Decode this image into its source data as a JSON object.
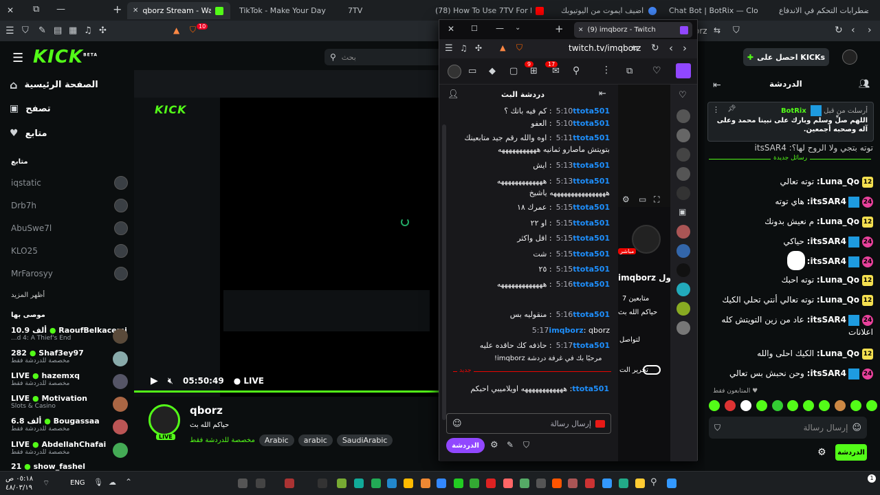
{
  "tabs": [
    {
      "label": "qborz Stream - Watch Live",
      "color": "#53fc18",
      "active": true
    },
    {
      "label": "TikTok - Make Your Day",
      "color": "#111111"
    },
    {
      "label": "7TV",
      "color": "#6f6f6f"
    },
    {
      "label": "(78) How To Use 7TV For Extra",
      "color": "#ff0000"
    },
    {
      "label": "كيف اضيف ايموت من اليوتيوبك",
      "color": "#4285f4"
    },
    {
      "label": "Chat Bot | BotRix — Cloud Stre",
      "color": "#5b8dee"
    },
    {
      "label": "اضطرابات التحكم في الاندفاع",
      "color": "#888888"
    }
  ],
  "toolbar": {
    "shield_count": "10",
    "url_partial": "orz"
  },
  "kick": {
    "logo": "KICK",
    "logo_beta": "BETA",
    "search_placeholder": "بحث",
    "nav": [
      {
        "label": "الصفحة الرئيسية",
        "icon": "home-icon"
      },
      {
        "label": "تصفح",
        "icon": "browse-icon"
      },
      {
        "label": "متابع",
        "icon": "heart-icon"
      }
    ],
    "following_title": "متابع",
    "following": [
      "iqstatic",
      "Drb7h",
      "AbuSwe7l",
      "KLO25",
      "MrFarosyy"
    ],
    "show_more": "أظهر المزيد",
    "recommended_title": "موصى بها",
    "recommended": [
      {
        "count": "10.9 ألف",
        "name": "RaoufBelkacemi",
        "sub": "...d 4: A Thief's End"
      },
      {
        "count": "282",
        "name": "Shaf3ey97",
        "sub": "مخصصة للدردشة فقط"
      },
      {
        "count": "LIVE",
        "name": "hazemxq",
        "sub": "مخصصة للدردشة فقط"
      },
      {
        "count": "LIVE",
        "name": "Motivation",
        "sub": "Slots & Casino"
      },
      {
        "count": "6.8 ألف",
        "name": "Bougassaa",
        "sub": "مخصصة للدردشة فقط"
      },
      {
        "count": "LIVE",
        "name": "AbdellahChafai",
        "sub": "مخصصة للدردشة فقط"
      },
      {
        "count": "21",
        "name": "show_fashel",
        "sub": ""
      }
    ],
    "player": {
      "time": "05:50:49",
      "live": "LIVE"
    },
    "streamer": {
      "name": "qborz",
      "title": "حياكم الله بث",
      "category": "مخصصة للدردشة فقط",
      "live_badge": "LIVE",
      "tags": [
        "Arabic",
        "arabic",
        "SaudiArabic"
      ]
    }
  },
  "twitch": {
    "tab_title": "(9) imqborz - Twitch",
    "url": "twitch.tv/imqborz",
    "badge_count": "9",
    "notif_count": "17",
    "chat_header": "دردشة البث",
    "messages": [
      {
        "time": "5:10",
        "user": "ttota501",
        "text": "كم فيه باتك ؟"
      },
      {
        "time": "5:10",
        "user": "ttota501",
        "text": "العفو"
      },
      {
        "time": "5:11",
        "user": "ttota501",
        "text": "اوه والله رقم جيد متابعينك بتويتش ماصارو ثمانيه هههههههههههه"
      },
      {
        "time": "5:13",
        "user": "ttota501",
        "text": "ايش"
      },
      {
        "time": "5:13",
        "user": "ttota501",
        "text": "هههههههههههههه ههههههههههههههههه ياشيخ"
      },
      {
        "time": "5:15",
        "user": "ttota501",
        "text": "عمرك ١٨"
      },
      {
        "time": "5:15",
        "user": "ttota501",
        "text": "او ٢٢"
      },
      {
        "time": "5:15",
        "user": "ttota501",
        "text": "اقل واكثر"
      },
      {
        "time": "5:15",
        "user": "ttota501",
        "text": "شت"
      },
      {
        "time": "5:15",
        "user": "ttota501",
        "text": "٢٥"
      },
      {
        "time": "5:16",
        "user": "ttota501",
        "text": "هههههههههههههه"
      },
      {
        "time": "5:16",
        "user": "ttota501",
        "text": "منقوليه بس"
      },
      {
        "time": "5:17",
        "user": "imqborz",
        "text": "qborz"
      },
      {
        "time": "5:17",
        "user": "ttota501",
        "text": "حاذفه كك حاقده عليه"
      }
    ],
    "welcome": "مرحبًا بك في غرفة دردشة imqborz!",
    "new_label": "جديد",
    "new_msg": {
      "user": "ttota501",
      "text": "ههههههههههههه اويلاميبي احبكم"
    },
    "input_placeholder": "إرسال رسالة",
    "chat_button": "الدردشة",
    "about_title": "حول imqborz",
    "followers": "7 متابعين",
    "bio": "حياكم الله بث",
    "social": "لتواصل",
    "edit_label": "تحرير الت",
    "live_label": "مباشر"
  },
  "kchat": {
    "get_kicks": "احصل على KICKs",
    "title": "الدردشة",
    "pinned_user": "BotRix",
    "pinned_by": "أرسلت من قبل",
    "pinned_text": "اللهم صلِّ وسلم وبارك على نبينا محمد وعلى آله وصحبه أجمعين.",
    "partial_msg": "توته بتجي ولا الروح لها؟: itsSAR4",
    "new_messages": "رسائل جديدة",
    "messages": [
      {
        "badge": "12",
        "user": "Luna_Qo",
        "text": "توته تعالي"
      },
      {
        "badge": "24",
        "user": "itsSAR4",
        "text": "هاي توته"
      },
      {
        "badge": "12",
        "user": "Luna_Qo",
        "text": "م نعيش بدونك"
      },
      {
        "badge": "24",
        "user": "itsSAR4",
        "text": "حياكي"
      },
      {
        "badge": "24",
        "user": "itsSAR4",
        "text": ""
      },
      {
        "badge": "12",
        "user": "Luna_Qo",
        "text": "توته احبك"
      },
      {
        "badge": "12",
        "user": "Luna_Qo",
        "text": "توته تعالي أنتي تحلي الكيك"
      },
      {
        "badge": "24",
        "user": "itsSAR4",
        "text": "عاد من زين التويتش كله اعلانات"
      },
      {
        "badge": "12",
        "user": "Luna_Qo",
        "text": "الكيك احلى والله"
      },
      {
        "badge": "24",
        "user": "itsSAR4",
        "text": "وحن نحبش بس تعالي"
      }
    ],
    "followers_only": "المتابعون فقط",
    "input_placeholder": "إرسال رسالة",
    "chat_button": "الدردشة"
  },
  "taskbar": {
    "lang": "ENG",
    "time": "٠٥:١٨ ص",
    "date": "٤٨/٠٣/١٩",
    "notif": "1"
  },
  "colors": {
    "kick_green": "#53fc18",
    "twitch_purple": "#9147ff",
    "twitch_name": "#1e90ff"
  }
}
